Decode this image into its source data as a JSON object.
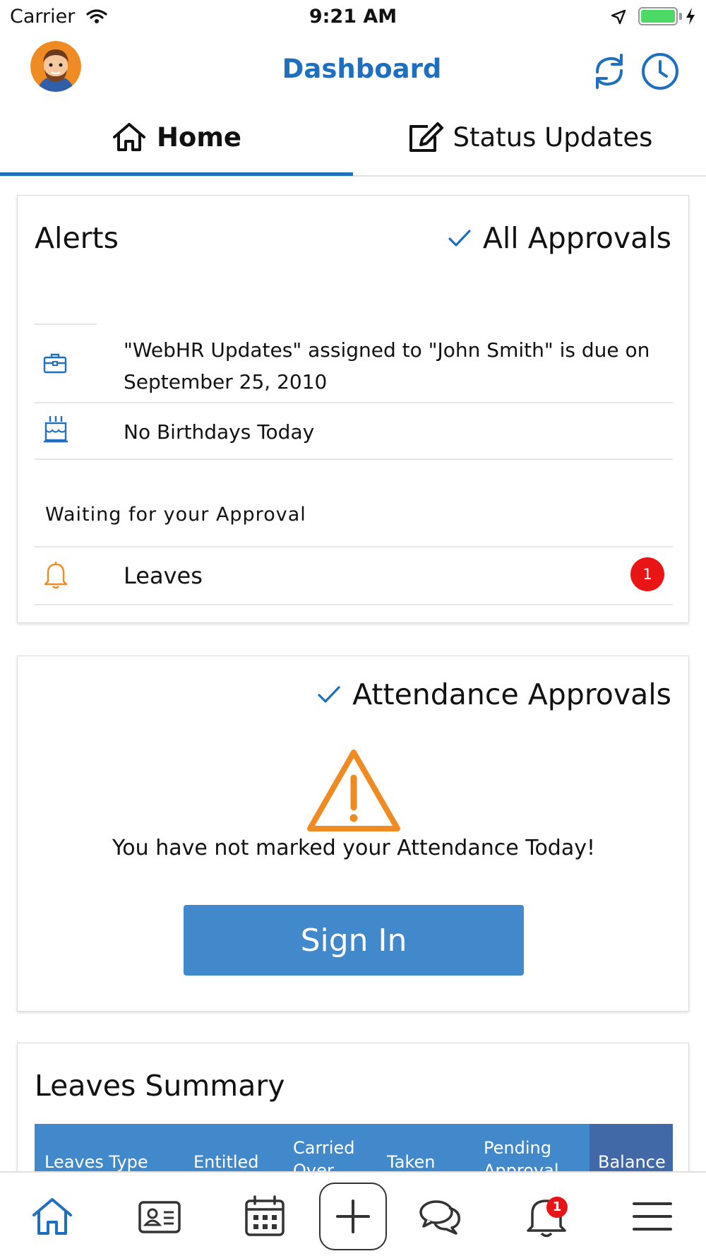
{
  "status_bar": {
    "carrier": "Carrier",
    "time": "9:21 AM",
    "battery_color": "#4cd964"
  },
  "header": {
    "title": "Dashboard",
    "title_color": "#1f6fc0",
    "left_icon": "avatar",
    "right_icons": [
      "sync-icon",
      "clock-icon"
    ]
  },
  "tabs": [
    {
      "label": "Home",
      "icon": "home-icon",
      "active": true
    },
    {
      "label": "Status Updates",
      "icon": "edit-icon",
      "active": false
    }
  ],
  "alerts_card": {
    "title": "Alerts",
    "approvals_link": "All Approvals",
    "items": [
      {
        "icon": "briefcase-icon",
        "text": "\"WebHR Updates\" assigned to \"John Smith\" is due on September 25, 2010"
      },
      {
        "icon": "birthday-cake-icon",
        "text": "No Birthdays Today"
      }
    ],
    "waiting_label": "Waiting for your Approval",
    "waiting_items": [
      {
        "icon": "bell-icon",
        "label": "Leaves",
        "count": "1"
      }
    ]
  },
  "attendance_card": {
    "approvals_link": "Attendance Approvals",
    "warning_icon": "warning-icon",
    "message": "You have not marked your Attendance Today!",
    "button_label": "Sign In",
    "button_color": "#4289cb"
  },
  "leaves_card": {
    "title": "Leaves Summary",
    "columns": [
      "Leaves Type",
      "Entitled",
      "Carried Over",
      "Taken",
      "Pending Approval",
      "Balance"
    ],
    "header_color": "#4289cb",
    "balance_color": "#4169a8"
  },
  "bottom_nav": {
    "items": [
      "home-icon",
      "contact-card-icon",
      "calendar-icon",
      "add-icon",
      "chat-icon",
      "bell-icon",
      "menu-icon"
    ],
    "notification_badge": "1"
  }
}
